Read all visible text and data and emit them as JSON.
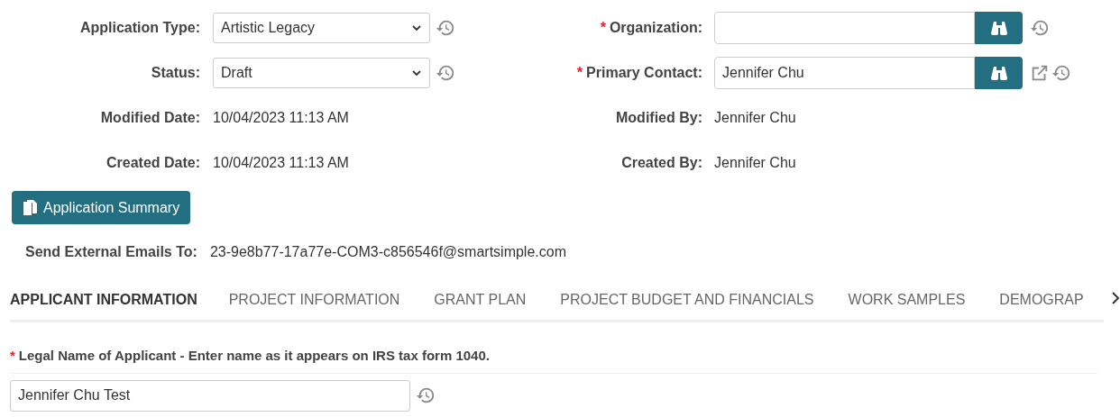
{
  "left_fields": [
    {
      "kind": "select",
      "label": "Application Type:",
      "value": "Artistic Legacy",
      "history": true
    },
    {
      "kind": "select",
      "label": "Status:",
      "value": "Draft",
      "history": true
    },
    {
      "kind": "text",
      "label": "Modified Date:",
      "value": "10/04/2023 11:13 AM"
    },
    {
      "kind": "text",
      "label": "Created Date:",
      "value": "10/04/2023 11:13 AM"
    }
  ],
  "right_fields": [
    {
      "kind": "lookup",
      "required_mark": "*",
      "label": "Organization:",
      "history": true,
      "open_link": false
    },
    {
      "kind": "lookup",
      "required_mark": "*",
      "label": "Primary Contact:",
      "value": "Jennifer Chu",
      "history": true,
      "open_link": true
    },
    {
      "kind": "text",
      "label": "Modified By:",
      "value": "Jennifer Chu"
    },
    {
      "kind": "text",
      "label": "Created By:",
      "value": "Jennifer Chu"
    }
  ],
  "summary_button": "Application Summary",
  "emails": {
    "label": "Send External Emails To:",
    "value": "23-9e8b77-17a77e-COM3-c856546f@smartsimple.com"
  },
  "tabs": [
    {
      "label": "APPLICANT INFORMATION",
      "selected": true
    },
    {
      "label": "PROJECT INFORMATION",
      "selected": false
    },
    {
      "label": "GRANT PLAN",
      "selected": false
    },
    {
      "label": "PROJECT BUDGET AND FINANCIALS",
      "selected": false
    },
    {
      "label": "WORK SAMPLES",
      "selected": false
    },
    {
      "label": "DEMOGRAP",
      "selected": false
    }
  ],
  "legal_name": {
    "required_mark": "*",
    "label": "Legal Name of Applicant - Enter name as it appears on IRS tax form 1040.",
    "value": "Jennifer Chu Test",
    "history": true
  }
}
